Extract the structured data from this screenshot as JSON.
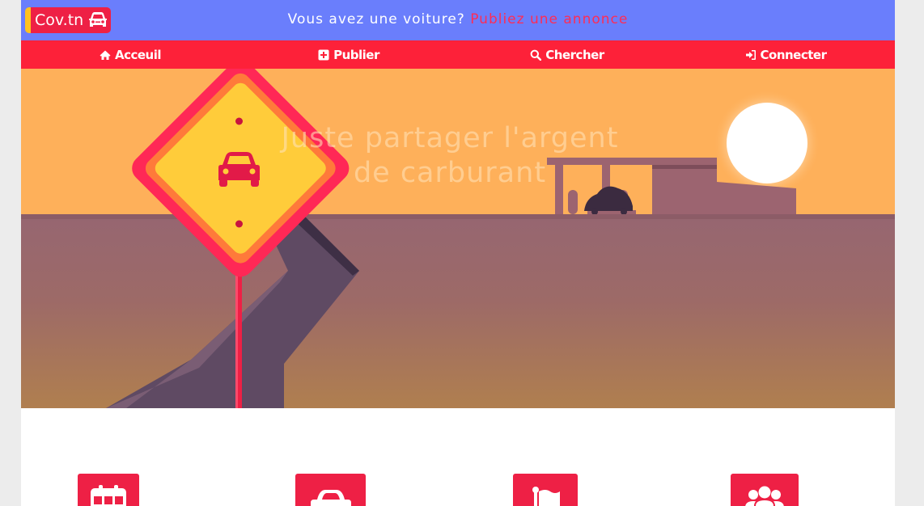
{
  "brand": {
    "name": "Cov.tn",
    "logo_icon": "car-icon"
  },
  "banner": {
    "question": "Vous avez une voiture?",
    "cta": "Publiez une annonce"
  },
  "nav": [
    {
      "label": "Acceuil",
      "icon": "home-icon"
    },
    {
      "label": "Publier",
      "icon": "plus-square-icon"
    },
    {
      "label": "Chercher",
      "icon": "search-icon"
    },
    {
      "label": "Connecter",
      "icon": "sign-in-icon"
    }
  ],
  "hero": {
    "line1": "Juste partager l'argent",
    "line2": "de carburant",
    "sign_icon": "car-icon"
  },
  "features": [
    {
      "icon": "calendar-icon"
    },
    {
      "icon": "car-icon"
    },
    {
      "icon": "flag-icon"
    },
    {
      "icon": "users-icon"
    }
  ],
  "colors": {
    "banner": "#6a7efc",
    "nav": "#fd2139",
    "accent": "#ee2045",
    "logo_stripe": "#ffc21f",
    "sky": "#feb05a",
    "ground": "#9a6671",
    "page_bg": "#ececec"
  }
}
